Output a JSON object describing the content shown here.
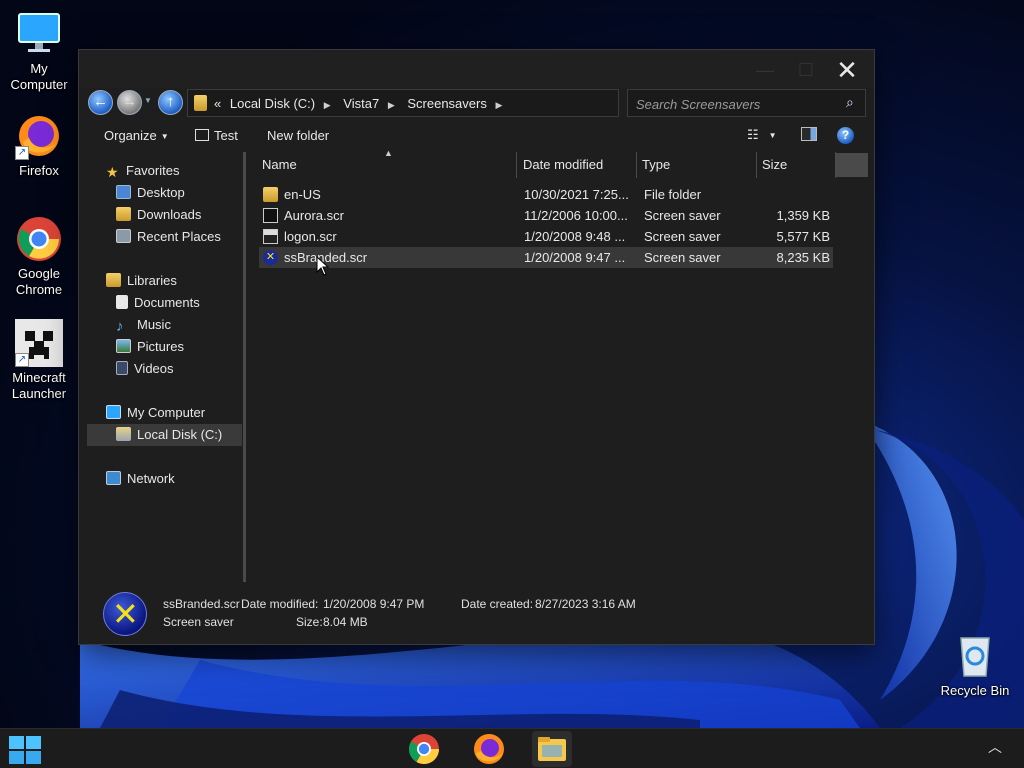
{
  "desktop": {
    "icons": [
      {
        "label1": "My",
        "label2": "Computer"
      },
      {
        "label1": "Firefox",
        "label2": ""
      },
      {
        "label1": "Google",
        "label2": "Chrome"
      },
      {
        "label1": "Minecraft",
        "label2": "Launcher"
      },
      {
        "label1": "Recycle Bin",
        "label2": ""
      }
    ]
  },
  "window": {
    "address": {
      "overflow": "«",
      "crumbs": [
        "Local Disk (C:)",
        "Vista7",
        "Screensavers"
      ]
    },
    "search": {
      "placeholder": "Search Screensavers"
    },
    "toolbar": {
      "organize": "Organize",
      "test": "Test",
      "new_folder": "New folder"
    },
    "nav": {
      "favorites": "Favorites",
      "desktop": "Desktop",
      "downloads": "Downloads",
      "recent_places": "Recent Places",
      "libraries": "Libraries",
      "documents": "Documents",
      "music": "Music",
      "pictures": "Pictures",
      "videos": "Videos",
      "my_computer": "My Computer",
      "local_disk": "Local Disk (C:)",
      "network": "Network"
    },
    "columns": {
      "name": "Name",
      "date": "Date modified",
      "type": "Type",
      "size": "Size"
    },
    "files": [
      {
        "name": "en-US",
        "date": "10/30/2021 7:25...",
        "type": "File folder",
        "size": "",
        "icon": "folder-icon"
      },
      {
        "name": "Aurora.scr",
        "date": "11/2/2006 10:00...",
        "type": "Screen saver",
        "size": "1,359 KB",
        "icon": "screensaver-icon"
      },
      {
        "name": "logon.scr",
        "date": "1/20/2008 9:48 ...",
        "type": "Screen saver",
        "size": "5,577 KB",
        "icon": "screensaver-icon"
      },
      {
        "name": "ssBranded.scr",
        "date": "1/20/2008 9:47 ...",
        "type": "Screen saver",
        "size": "8,235 KB",
        "icon": "branded-screensaver-icon"
      }
    ],
    "details": {
      "filename": "ssBranded.scr",
      "modified_label": "Date modified:",
      "modified_value": "1/20/2008 9:47 PM",
      "created_label": "Date created:",
      "created_value": "8/27/2023 3:16 AM",
      "type": "Screen saver",
      "size_label": "Size:",
      "size_value": "8.04 MB"
    }
  },
  "taskbar": {
    "apps": [
      "chrome-icon",
      "firefox-icon",
      "file-explorer-icon"
    ]
  }
}
